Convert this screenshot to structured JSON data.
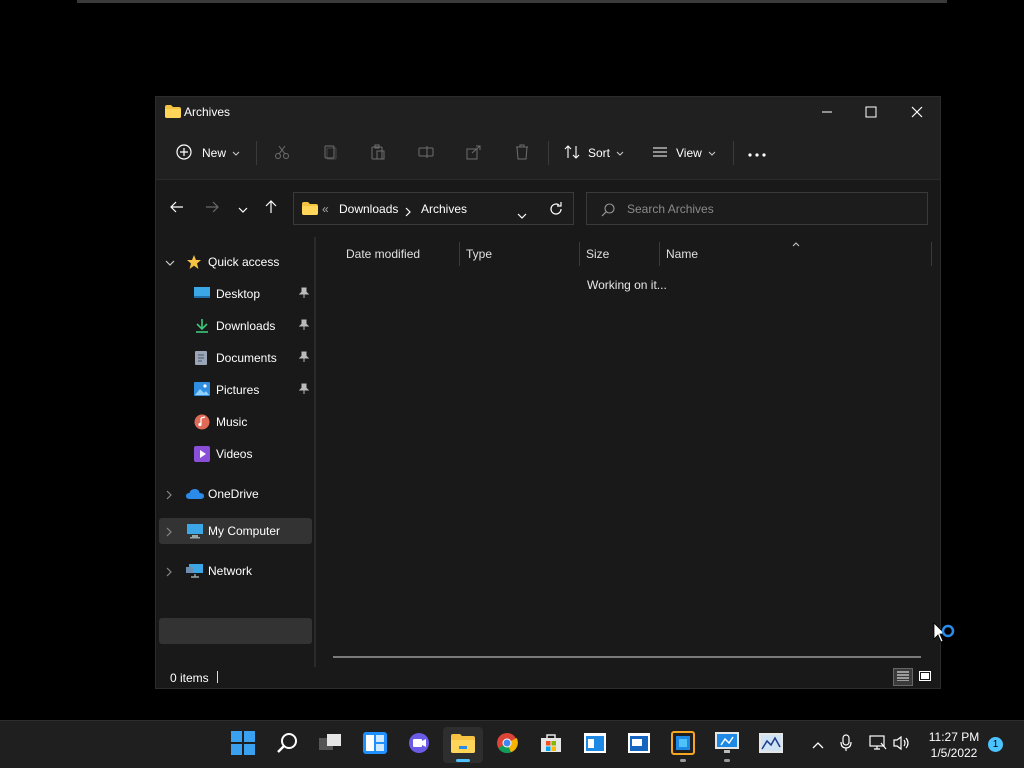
{
  "window": {
    "title": "Archives"
  },
  "commandbar": {
    "new_label": "New",
    "sort_label": "Sort",
    "view_label": "View"
  },
  "address": {
    "overflow": "«",
    "crumbs": [
      "Downloads",
      "Archives"
    ]
  },
  "search": {
    "placeholder": "Search Archives"
  },
  "nav": {
    "quick_access": "Quick access",
    "items": [
      {
        "label": "Desktop",
        "icon": "desktop-icon"
      },
      {
        "label": "Downloads",
        "icon": "download-icon"
      },
      {
        "label": "Documents",
        "icon": "document-icon"
      },
      {
        "label": "Pictures",
        "icon": "picture-icon"
      },
      {
        "label": "Music",
        "icon": "music-icon"
      },
      {
        "label": "Videos",
        "icon": "video-icon"
      }
    ],
    "onedrive": "OneDrive",
    "my_computer": "My Computer",
    "network": "Network"
  },
  "columns": {
    "date_modified": "Date modified",
    "type": "Type",
    "size": "Size",
    "name": "Name"
  },
  "content": {
    "status": "Working on it..."
  },
  "statusbar": {
    "item_count": "0 items"
  },
  "taskbar": {
    "time": "11:27 PM",
    "date": "1/5/2022",
    "notifications": "1"
  },
  "colors": {
    "accent": "#4cc2ff",
    "background": "#191919",
    "chrome": "#202020"
  }
}
